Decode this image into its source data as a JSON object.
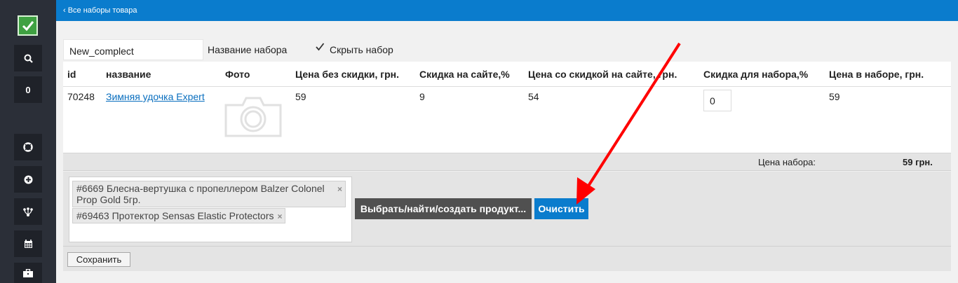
{
  "topbar": {
    "back_link": "‹ Все наборы товара"
  },
  "sidebar": {
    "counter": "0",
    "icons": [
      "check-icon",
      "search-icon",
      "lifebuoy-icon",
      "plus-circle-icon",
      "sitemap-icon",
      "calendar-icon",
      "briefcase-icon"
    ]
  },
  "set_form": {
    "name_value": "New_complect",
    "name_label": "Название набора",
    "hide_checked": true,
    "hide_label": "Скрыть набор"
  },
  "table": {
    "headers": [
      "id",
      "название",
      "Фото",
      "Цена без скидки, грн.",
      "Скидка на сайте,%",
      "Цена со скидкой на сайте, грн.",
      "Скидка для набора,%",
      "Цена в наборе, грн."
    ],
    "rows": [
      {
        "id": "70248",
        "name": "Зимняя удочка Expert",
        "price": "59",
        "site_discount": "9",
        "discounted_price": "54",
        "set_discount": "0",
        "set_price": "59"
      }
    ]
  },
  "total": {
    "label": "Цена набора:",
    "value": "59 грн."
  },
  "products": {
    "tags": [
      {
        "line1": "#6669 Блесна-вертушка с пропеллером Balzer Colonel",
        "line2": "Prop Gold 5гр."
      },
      {
        "text": "#69463 Протектор Sensas Elastic Protectors"
      }
    ],
    "remove_symbol": "×",
    "choose_button": "Выбрать/найти/создать продукт...",
    "clear_button": "Очистить"
  },
  "save_button": "Сохранить",
  "colors": {
    "accent": "#0a7ccd",
    "sidebar": "#2b2f38",
    "annotation": "#ff0000"
  }
}
